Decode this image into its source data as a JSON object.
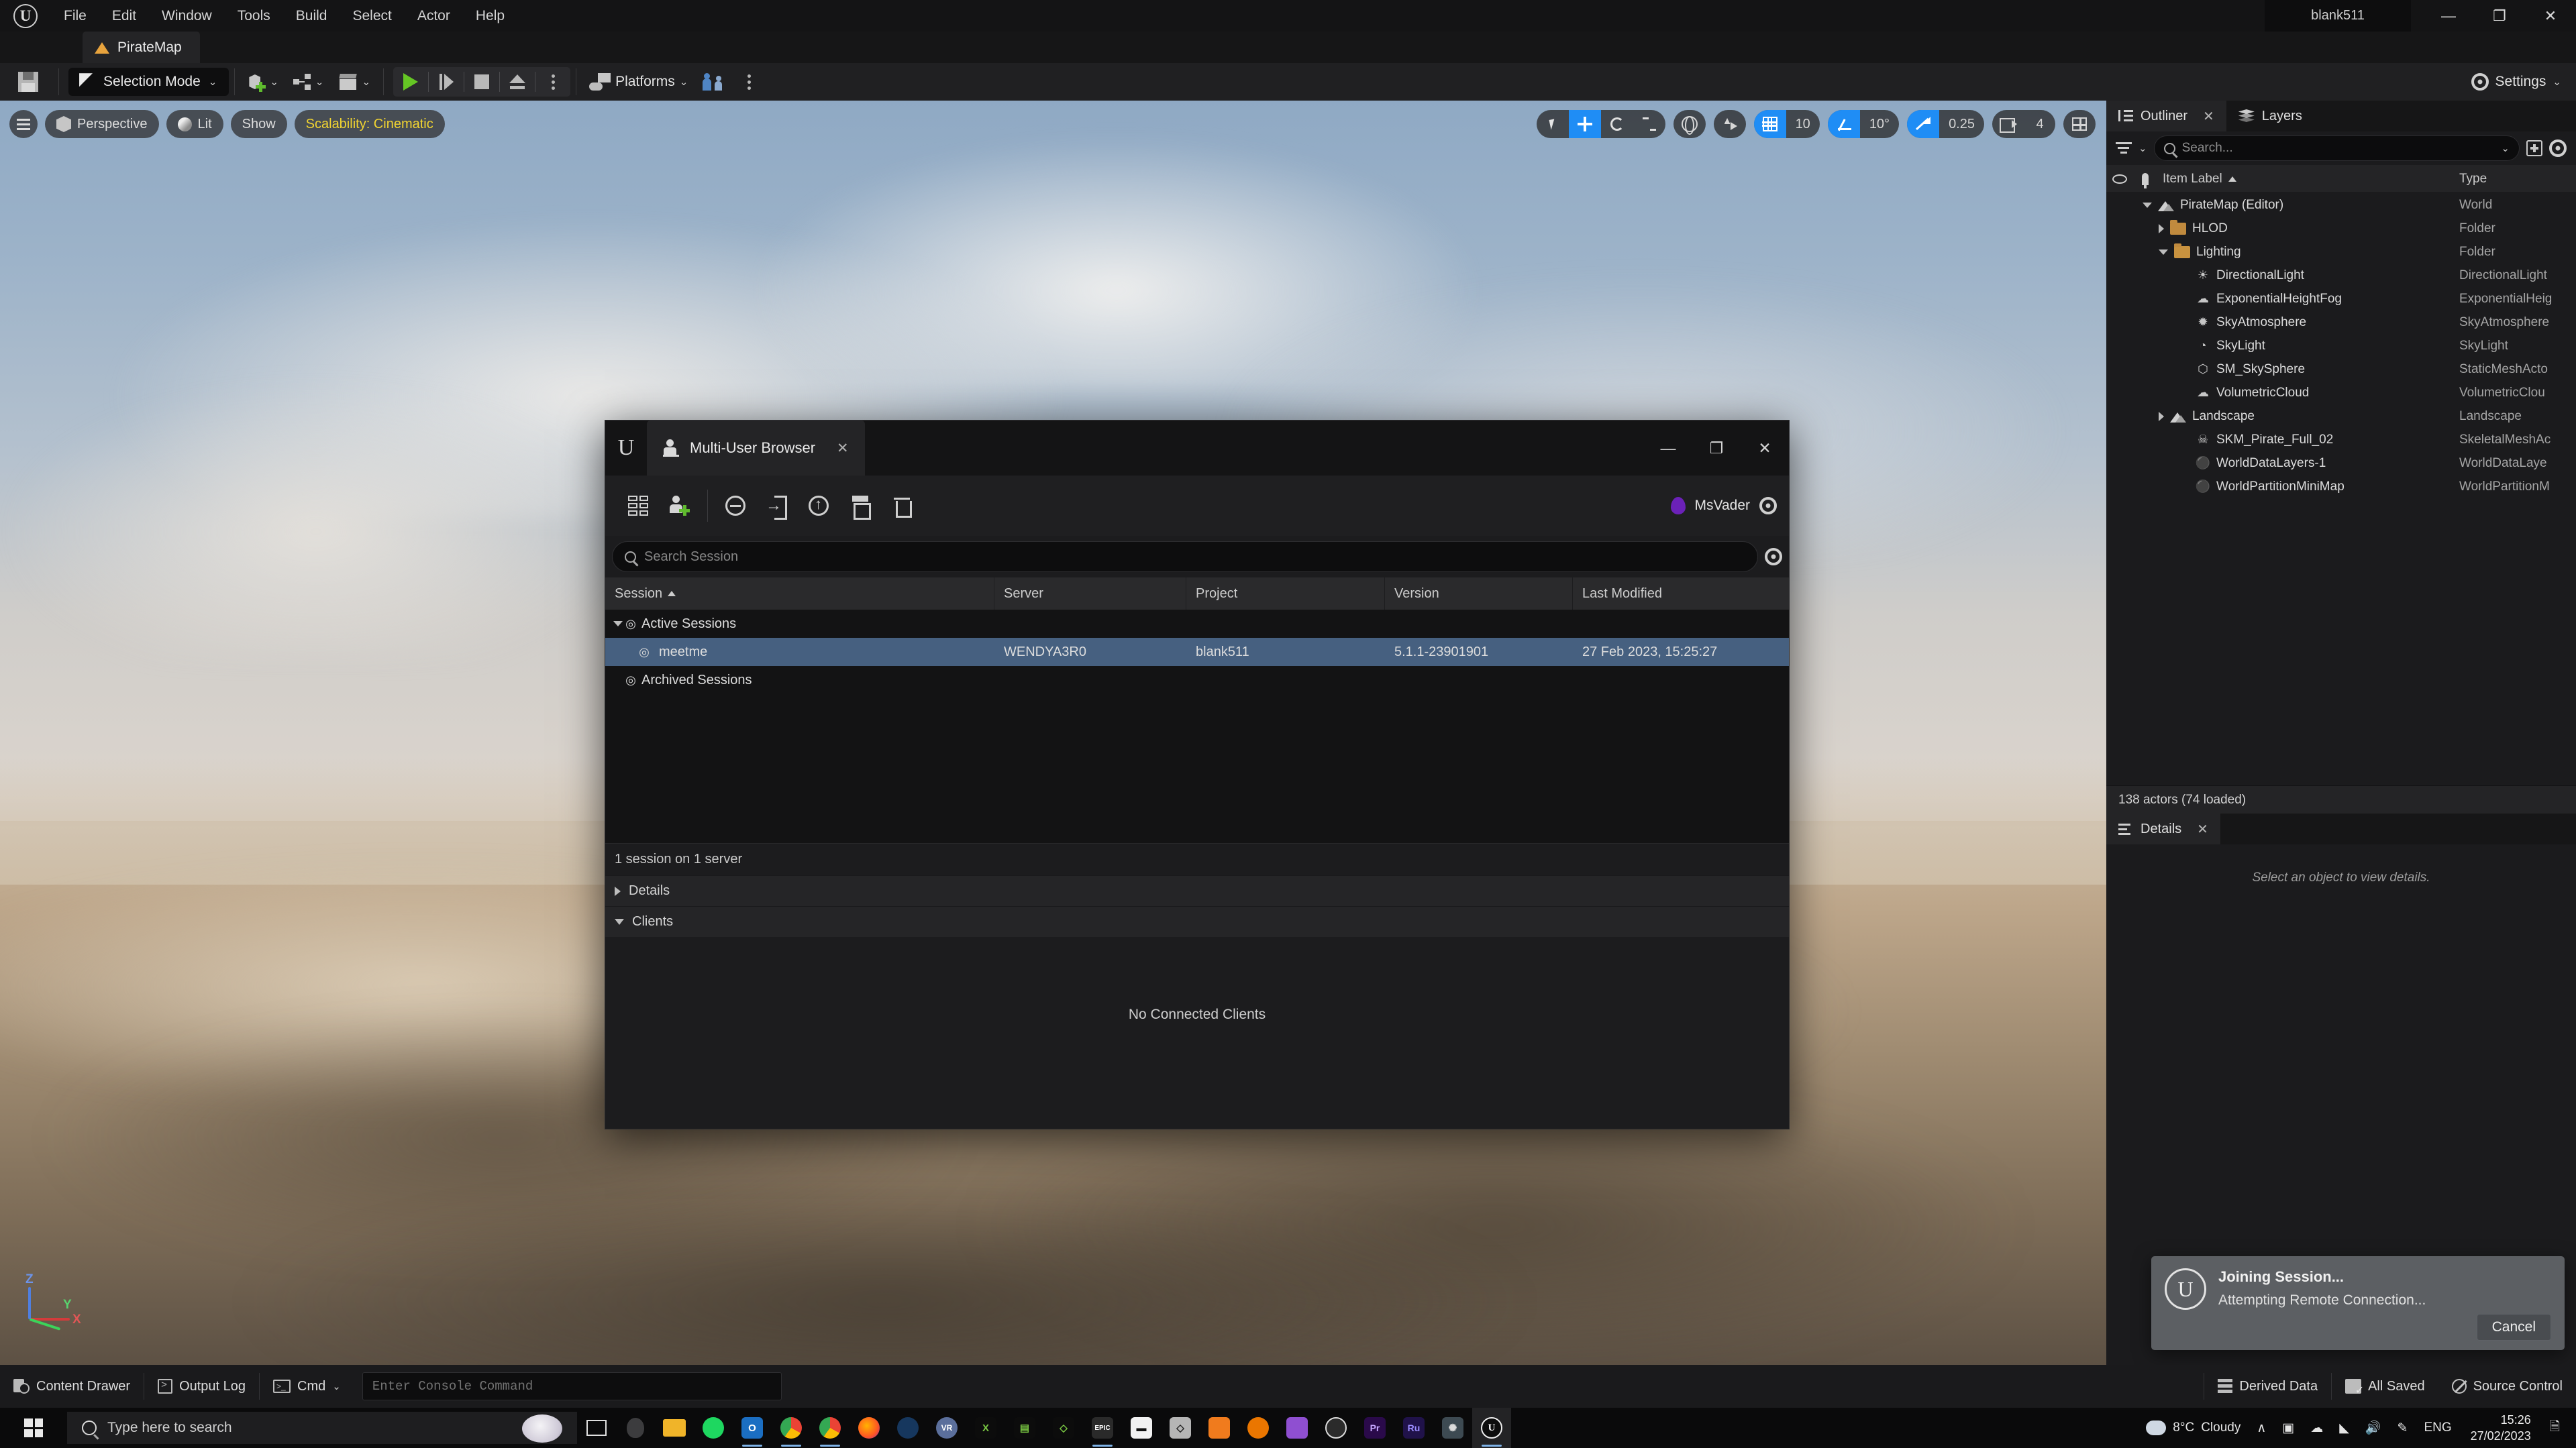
{
  "titlebar": {
    "menu": [
      "File",
      "Edit",
      "Window",
      "Tools",
      "Build",
      "Select",
      "Actor",
      "Help"
    ],
    "window_title": "blank511",
    "minimize": "—",
    "maximize": "❐",
    "close": "✕"
  },
  "map_tab": {
    "label": "PirateMap"
  },
  "toolbar": {
    "selection_mode": "Selection Mode",
    "chevron": "⌄",
    "platforms": "Platforms",
    "settings": "Settings"
  },
  "viewport": {
    "perspective": "Perspective",
    "lit": "Lit",
    "show": "Show",
    "scalability": "Scalability: Cinematic",
    "grid_snap_value": "10",
    "angle_snap_value": "10°",
    "scale_snap_value": "0.25",
    "camera_speed": "4",
    "gizmo": {
      "x": "X",
      "y": "Y",
      "z": "Z"
    }
  },
  "outliner": {
    "tab_outliner": "Outliner",
    "tab_layers": "Layers",
    "close_x": "✕",
    "search_placeholder": "Search...",
    "col_item_label": "Item Label",
    "col_type": "Type",
    "actors_status": "138 actors (74 loaded)",
    "items": [
      {
        "label": "PirateMap (Editor)",
        "type": "World",
        "indent": 1,
        "disc": "open",
        "icon": "world-icon"
      },
      {
        "label": "HLOD",
        "type": "Folder",
        "indent": 2,
        "disc": "closed",
        "icon": "folder-icon"
      },
      {
        "label": "Lighting",
        "type": "Folder",
        "indent": 2,
        "disc": "open",
        "icon": "folder-open-icon"
      },
      {
        "label": "DirectionalLight",
        "type": "DirectionalLight",
        "indent": 3,
        "disc": "none",
        "icon": "directional-light-icon"
      },
      {
        "label": "ExponentialHeightFog",
        "type": "ExponentialHeig",
        "indent": 3,
        "disc": "none",
        "icon": "fog-icon"
      },
      {
        "label": "SkyAtmosphere",
        "type": "SkyAtmosphere",
        "indent": 3,
        "disc": "none",
        "icon": "sky-atmosphere-icon"
      },
      {
        "label": "SkyLight",
        "type": "SkyLight",
        "indent": 3,
        "disc": "none",
        "icon": "sky-light-icon"
      },
      {
        "label": "SM_SkySphere",
        "type": "StaticMeshActo",
        "indent": 3,
        "disc": "none",
        "icon": "static-mesh-icon"
      },
      {
        "label": "VolumetricCloud",
        "type": "VolumetricClou",
        "indent": 3,
        "disc": "none",
        "icon": "cloud-icon"
      },
      {
        "label": "Landscape",
        "type": "Landscape",
        "indent": 2,
        "disc": "closed",
        "icon": "landscape-icon"
      },
      {
        "label": "SKM_Pirate_Full_02",
        "type": "SkeletalMeshAc",
        "indent": 3,
        "disc": "none",
        "icon": "skeletal-mesh-icon"
      },
      {
        "label": "WorldDataLayers-1",
        "type": "WorldDataLaye",
        "indent": 3,
        "disc": "none",
        "icon": "actor-icon"
      },
      {
        "label": "WorldPartitionMiniMap",
        "type": "WorldPartitionM",
        "indent": 3,
        "disc": "none",
        "icon": "actor-icon"
      }
    ]
  },
  "details": {
    "tab_label": "Details",
    "close_x": "✕",
    "empty_message": "Select an object to view details."
  },
  "multi_user_browser": {
    "tab_label": "Multi-User Browser",
    "tab_close": "✕",
    "minimize": "—",
    "maximize": "❐",
    "close": "✕",
    "user_name": "MsVader",
    "user_color": "#6b21b8",
    "search_placeholder": "Search Session",
    "columns": [
      "Session",
      "Server",
      "Project",
      "Version",
      "Last Modified"
    ],
    "sort_indicator": "▲",
    "groups": [
      {
        "label": "Active Sessions",
        "expanded": true
      },
      {
        "label": "Archived Sessions",
        "expanded": false
      }
    ],
    "session_row": {
      "session": "meetme",
      "server": "WENDYA3R0",
      "project": "blank511",
      "version": "5.1.1-23901901",
      "last_modified": "27 Feb 2023, 15:25:27",
      "selected": true
    },
    "status": "1 session on 1 server",
    "section_details": "Details",
    "section_clients": "Clients",
    "clients_empty": "No Connected Clients"
  },
  "notification": {
    "title": "Joining Session...",
    "subtitle": "Attempting Remote Connection...",
    "cancel_label": "Cancel"
  },
  "statusbar": {
    "content_drawer": "Content Drawer",
    "output_log": "Output Log",
    "cmd": "Cmd",
    "console_placeholder": "Enter Console Command",
    "derived_data": "Derived Data",
    "all_saved": "All Saved",
    "source_control": "Source Control"
  },
  "taskbar": {
    "search_placeholder": "Type here to search",
    "weather_temp": "8°C",
    "weather_desc": "Cloudy",
    "chevron_up": "∧",
    "language": "ENG",
    "time": "15:26",
    "date": "27/02/2023"
  }
}
